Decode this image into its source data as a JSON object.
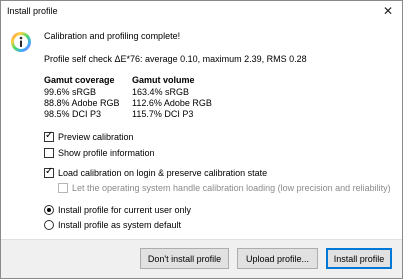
{
  "window": {
    "title": "Install profile",
    "close_glyph": "✕"
  },
  "message": {
    "headline": "Calibration and profiling complete!",
    "selfcheck": "Profile self check ΔE*76: average 0.10, maximum 2.39, RMS 0.28"
  },
  "gamut": {
    "coverage_header": "Gamut coverage",
    "volume_header": "Gamut volume",
    "coverage": [
      "99.6% sRGB",
      "88.8% Adobe RGB",
      "98.5% DCI P3"
    ],
    "volume": [
      "163.4% sRGB",
      "112.6% Adobe RGB",
      "115.7% DCI P3"
    ]
  },
  "options": {
    "preview_calibration": {
      "label": "Preview calibration",
      "checked": true
    },
    "show_profile_info": {
      "label": "Show profile information",
      "checked": false
    },
    "load_calibration": {
      "label": "Load calibration on login & preserve calibration state",
      "checked": true
    },
    "os_handle": {
      "label": "Let the operating system handle calibration loading (low precision and reliability)",
      "checked": false,
      "disabled": true
    }
  },
  "install_scope": {
    "current_user": {
      "label": "Install profile for current user only",
      "selected": true
    },
    "system_default": {
      "label": "Install profile as system default",
      "selected": false
    }
  },
  "buttons": {
    "dont_install": "Don't install profile",
    "upload": "Upload profile...",
    "install": "Install profile"
  },
  "colors": {
    "accent": "#0078d7",
    "footer_bg": "#f0f0f0",
    "button_bg": "#e1e1e1",
    "disabled_text": "#8a8a8a"
  }
}
